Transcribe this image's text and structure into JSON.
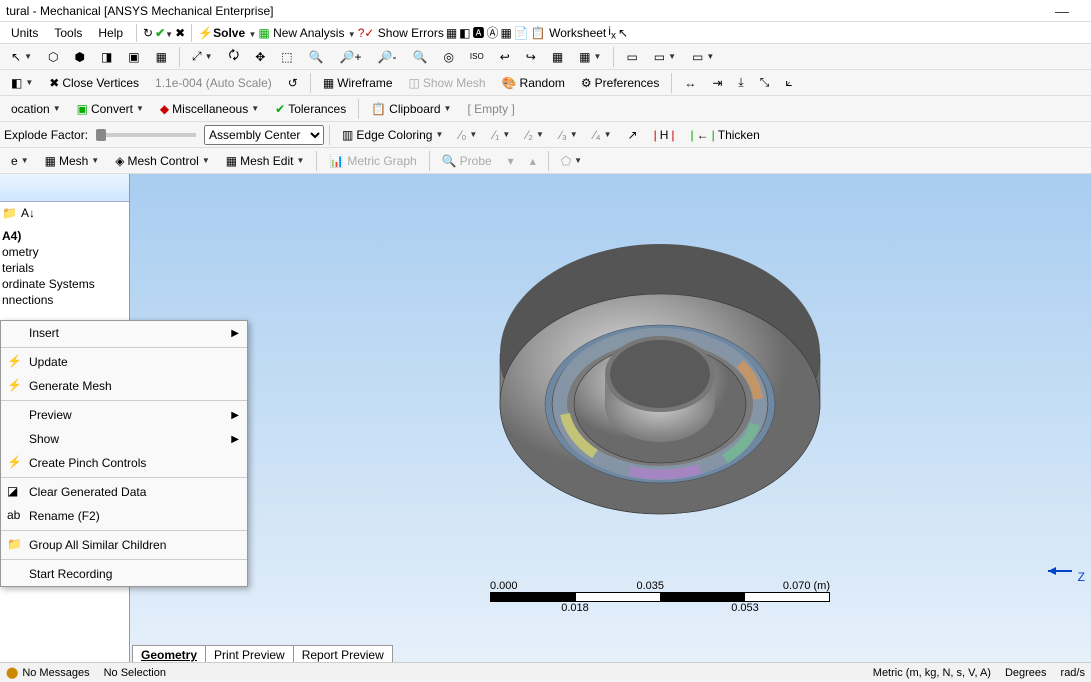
{
  "title": "tural - Mechanical [ANSYS Mechanical Enterprise]",
  "menus": {
    "units": "Units",
    "tools": "Tools",
    "help": "Help"
  },
  "tb1": {
    "solve": "Solve",
    "newAnalysis": "New Analysis",
    "showErrors": "Show Errors",
    "worksheet": "Worksheet"
  },
  "tb2": {
    "closeVertices": "Close Vertices",
    "autoScale": "1.1e-004 (Auto Scale)",
    "wireframe": "Wireframe",
    "showMesh": "Show Mesh",
    "random": "Random",
    "preferences": "Preferences"
  },
  "tb3": {
    "location": "ocation",
    "convert": "Convert",
    "misc": "Miscellaneous",
    "tolerances": "Tolerances",
    "clipboard": "Clipboard",
    "empty": "[ Empty ]"
  },
  "tb4": {
    "explode": "Explode Factor:",
    "asmCenter": "Assembly Center",
    "edgeColor": "Edge Coloring",
    "thicken": "Thicken"
  },
  "tb5": {
    "mesh": "Mesh",
    "meshControl": "Mesh Control",
    "meshEdit": "Mesh Edit",
    "metric": "Metric Graph",
    "probe": "Probe"
  },
  "tree": {
    "a4": "A4)",
    "geometry": "ometry",
    "materials": "terials",
    "coords": "ordinate Systems",
    "connections": "nnections"
  },
  "ctx": {
    "insert": "Insert",
    "update": "Update",
    "generate": "Generate Mesh",
    "preview": "Preview",
    "show": "Show",
    "pinch": "Create Pinch Controls",
    "clear": "Clear Generated Data",
    "rename": "Rename (F2)",
    "group": "Group All Similar Children",
    "record": "Start Recording"
  },
  "scale": {
    "v0": "0.000",
    "v1": "0.035",
    "v2": "0.070 (m)",
    "v3": "0.018",
    "v4": "0.053"
  },
  "tabs": {
    "geom": "Geometry",
    "print": "Print Preview",
    "report": "Report Preview"
  },
  "status": {
    "noMsg": "No Messages",
    "noSel": "No Selection",
    "metric": "Metric (m, kg, N, s, V, A)",
    "deg": "Degrees",
    "rads": "rad/s"
  },
  "triad": "Z"
}
